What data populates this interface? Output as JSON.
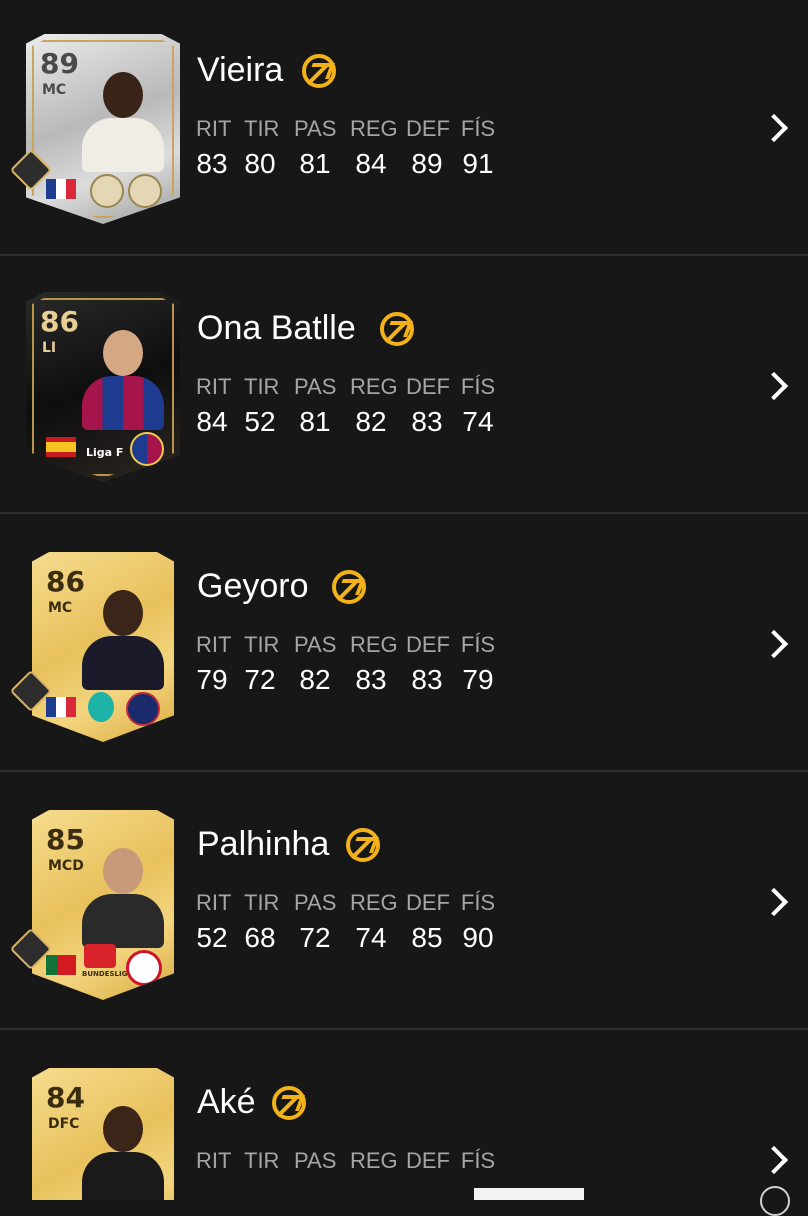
{
  "players": [
    {
      "name": "Vieira",
      "rating": "89",
      "position": "MC",
      "stat_labels": [
        "RIT",
        "TIR",
        "PAS",
        "REG",
        "DEF",
        "FÍS"
      ],
      "stat_values": [
        "83",
        "80",
        "81",
        "84",
        "89",
        "91"
      ],
      "card_style": "icon",
      "flag": "fr"
    },
    {
      "name": "Ona Batlle",
      "rating": "86",
      "position": "LI",
      "stat_labels": [
        "RIT",
        "TIR",
        "PAS",
        "REG",
        "DEF",
        "FÍS"
      ],
      "stat_values": [
        "84",
        "52",
        "81",
        "82",
        "83",
        "74"
      ],
      "card_style": "black",
      "flag": "es",
      "league_label": "Liga F"
    },
    {
      "name": "Geyoro",
      "rating": "86",
      "position": "MC",
      "stat_labels": [
        "RIT",
        "TIR",
        "PAS",
        "REG",
        "DEF",
        "FÍS"
      ],
      "stat_values": [
        "79",
        "72",
        "82",
        "83",
        "83",
        "79"
      ],
      "card_style": "gold",
      "flag": "fr"
    },
    {
      "name": "Palhinha",
      "rating": "85",
      "position": "MCD",
      "stat_labels": [
        "RIT",
        "TIR",
        "PAS",
        "REG",
        "DEF",
        "FÍS"
      ],
      "stat_values": [
        "52",
        "68",
        "72",
        "74",
        "85",
        "90"
      ],
      "card_style": "gold",
      "flag": "pt",
      "league_label": "BUNDESLIGA"
    },
    {
      "name": "Aké",
      "rating": "84",
      "position": "DFC",
      "stat_labels": [
        "RIT",
        "TIR",
        "PAS",
        "REG",
        "DEF",
        "FÍS"
      ],
      "stat_values": [
        "",
        "",
        "",
        "",
        "",
        ""
      ],
      "card_style": "gold",
      "flag": ""
    }
  ],
  "colors": {
    "background": "#171717",
    "accent_swap": "#f2b218",
    "stat_label": "#a5a5a5"
  },
  "icons": {
    "swap": "swap-icon",
    "chevron": "chevron-right-icon"
  }
}
